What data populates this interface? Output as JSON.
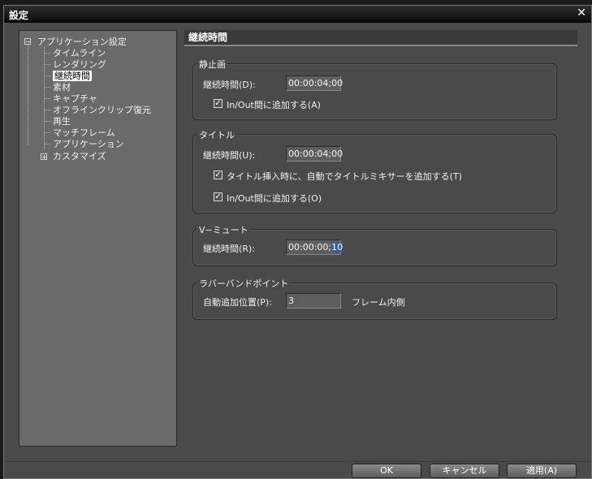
{
  "window": {
    "title": "設定",
    "close_glyph": "✕"
  },
  "tree": {
    "root_label": "アプリケーション設定",
    "items": [
      "タイムライン",
      "レンダリング",
      "継続時間",
      "素材",
      "キャプチャ",
      "オフラインクリップ復元",
      "再生",
      "マッチフレーム",
      "アプリケーション"
    ],
    "selected_index": 2,
    "customize_label": "カスタマイズ",
    "collapse_glyph": "−",
    "expand_glyph": "+"
  },
  "panel": {
    "header": "継続時間"
  },
  "still": {
    "group_title": "静止画",
    "duration_label": "継続時間(D):",
    "duration_value": "00:00:04;00",
    "add_inout_label": "In/Out間に追加する(A)",
    "add_inout_checked": true
  },
  "title_group": {
    "group_title": "タイトル",
    "duration_label": "継続時間(U):",
    "duration_value": "00:00:04;00",
    "mixer_label": "タイトル挿入時に、自動でタイトルミキサーを追加する(T)",
    "mixer_checked": true,
    "add_inout_label": "In/Out間に追加する(O)",
    "add_inout_checked": true
  },
  "vmute": {
    "group_title": "V−ミュート",
    "duration_label": "継続時間(R):",
    "duration_prefix": "00:00:00;",
    "duration_selected": "10"
  },
  "rubberband": {
    "group_title": "ラバーバンドポイント",
    "position_label": "自動追加位置(P):",
    "position_value": "3",
    "unit_label": "フレーム内側"
  },
  "buttons": {
    "ok": "OK",
    "cancel": "キャンセル",
    "apply": "適用(A)"
  },
  "check_glyph": "✓"
}
